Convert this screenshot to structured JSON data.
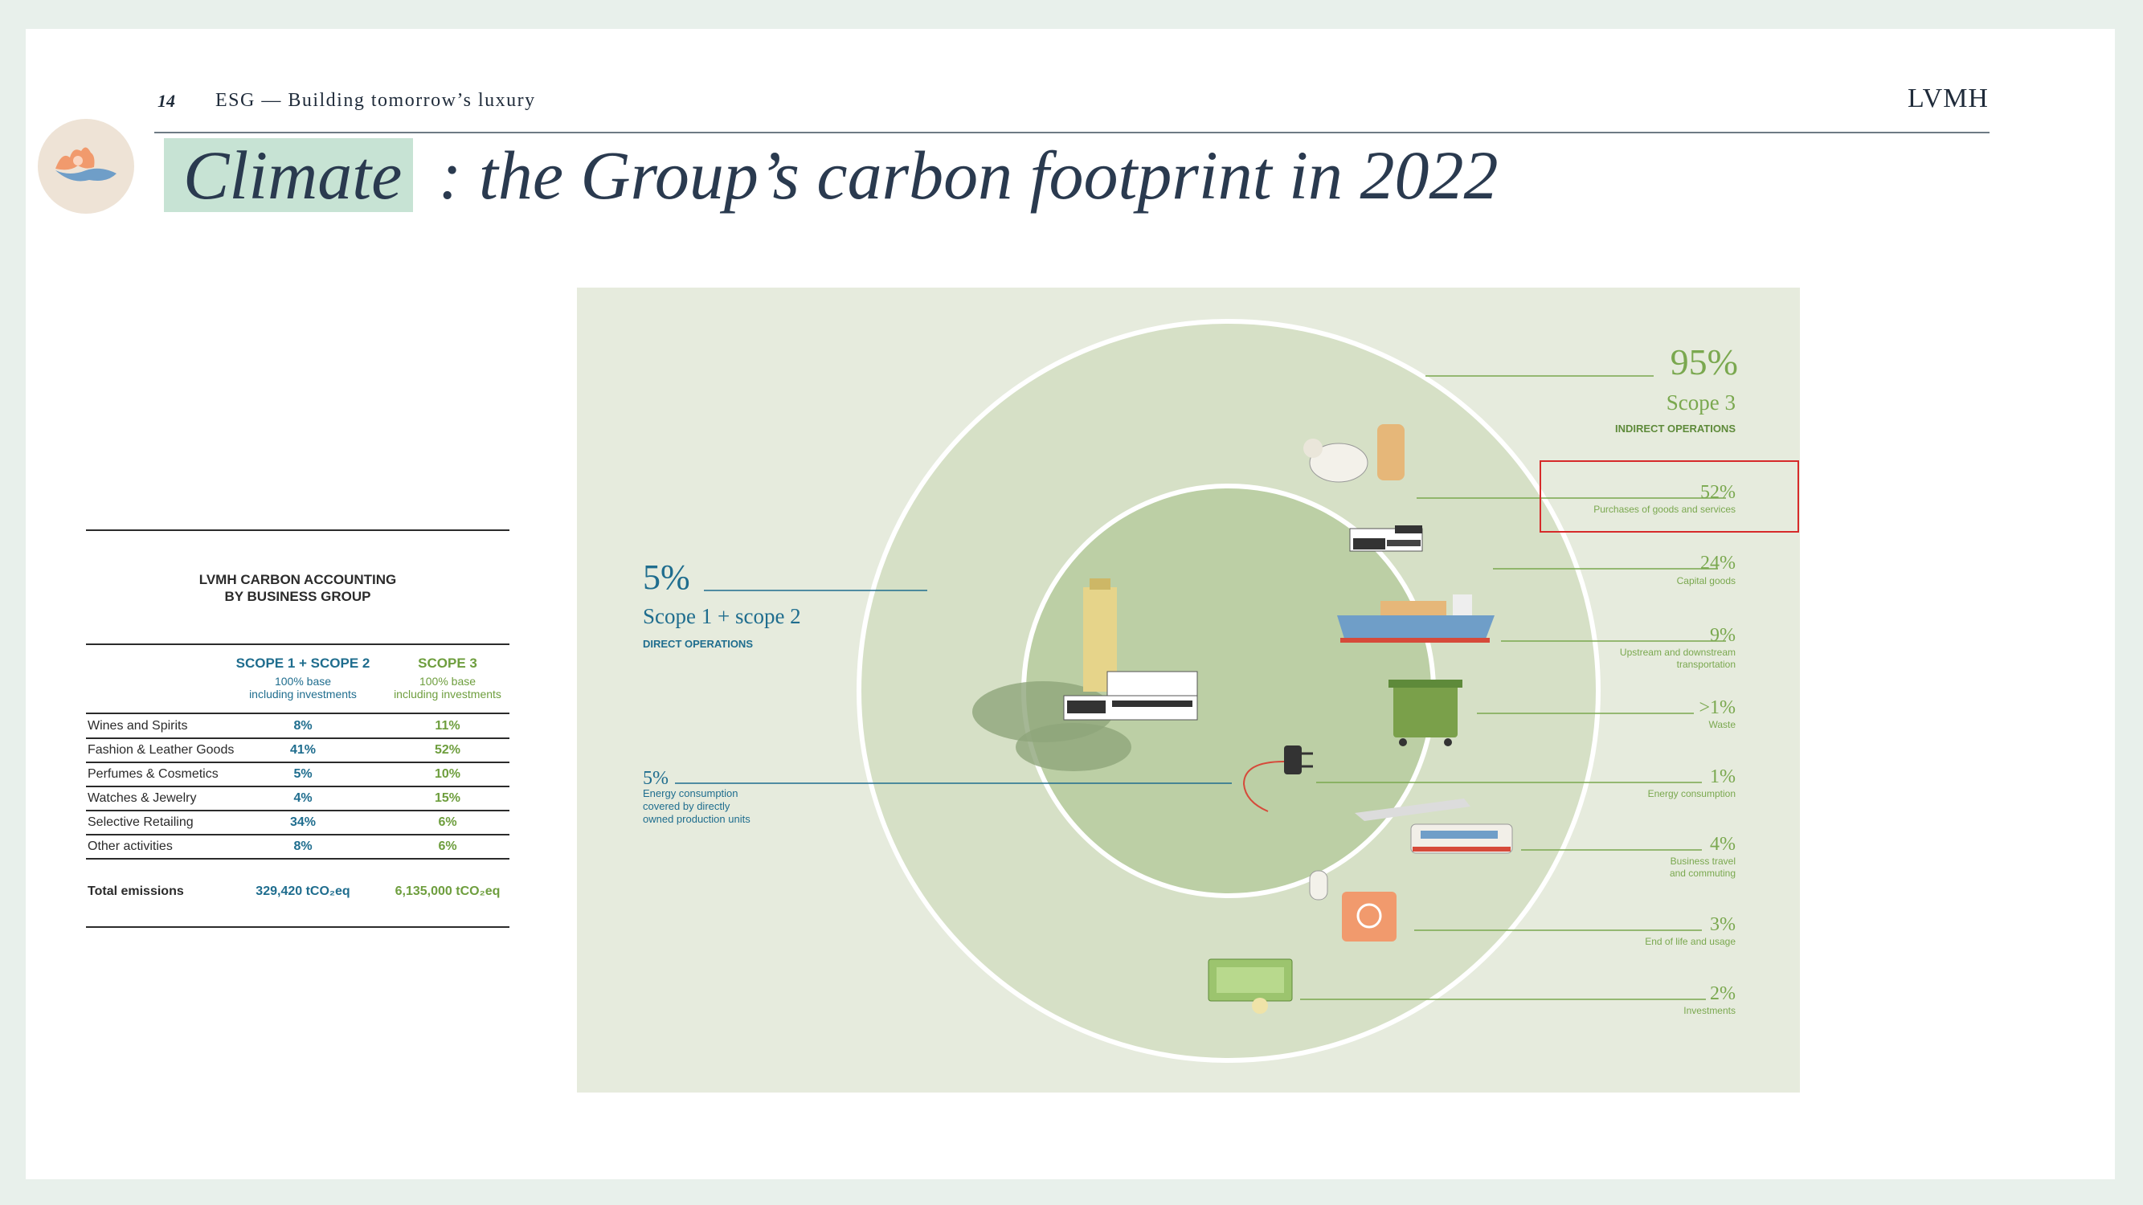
{
  "header": {
    "page_number": "14",
    "section_title": "ESG — Building tomorrow’s luxury",
    "brand": "LVMH"
  },
  "title": {
    "highlight": "Climate",
    "separator": ":",
    "rest": "the Group’s carbon footprint in 2022"
  },
  "table": {
    "title_line1": "LVMH CARBON ACCOUNTING",
    "title_line2": "BY BUSINESS GROUP",
    "col1_head": "SCOPE 1 + SCOPE 2",
    "col1_sub1": "100% base",
    "col1_sub2": "including investments",
    "col2_head": "SCOPE 3",
    "col2_sub1": "100% base",
    "col2_sub2": "including investments",
    "rows": [
      {
        "label": "Wines and Spirits",
        "scope12": "8%",
        "scope3": "11%"
      },
      {
        "label": "Fashion & Leather Goods",
        "scope12": "41%",
        "scope3": "52%"
      },
      {
        "label": "Perfumes & Cosmetics",
        "scope12": "5%",
        "scope3": "10%"
      },
      {
        "label": "Watches & Jewelry",
        "scope12": "4%",
        "scope3": "15%"
      },
      {
        "label": "Selective Retailing",
        "scope12": "34%",
        "scope3": "6%"
      },
      {
        "label": "Other activities",
        "scope12": "8%",
        "scope3": "6%"
      }
    ],
    "total_label": "Total emissions",
    "total_scope12": "329,420 tCO₂eq",
    "total_scope3": "6,135,000 tCO₂eq"
  },
  "infographic": {
    "scope3": {
      "pct": "95%",
      "name": "Scope 3",
      "sub": "INDIRECT OPERATIONS"
    },
    "scope12": {
      "pct": "5%",
      "name": "Scope 1 + scope 2",
      "sub": "DIRECT OPERATIONS"
    },
    "energy_left": {
      "pct": "5%",
      "line1": "Energy consumption",
      "line2": "covered by directly",
      "line3": "owned production units"
    },
    "items": [
      {
        "pct": "52%",
        "line1": "Purchases of goods and services",
        "line2": ""
      },
      {
        "pct": "24%",
        "line1": "Capital goods",
        "line2": ""
      },
      {
        "pct": "9%",
        "line1": "Upstream and downstream",
        "line2": "transportation"
      },
      {
        "pct": ">1%",
        "line1": "Waste",
        "line2": ""
      },
      {
        "pct": "1%",
        "line1": "Energy consumption",
        "line2": ""
      },
      {
        "pct": "4%",
        "line1": "Business travel",
        "line2": "and commuting"
      },
      {
        "pct": "3%",
        "line1": "End of life and usage",
        "line2": ""
      },
      {
        "pct": "2%",
        "line1": "Investments",
        "line2": ""
      }
    ]
  },
  "colors": {
    "panel_bg": "#e6ebdd",
    "outer_circle": "#d6e0c6",
    "inner_circle": "#bccfa5",
    "scope3_green": "#7aa84f",
    "scope12_blue": "#1f6d8e",
    "highlight": "#c7e3d4",
    "selection_red": "#d62a2a"
  }
}
